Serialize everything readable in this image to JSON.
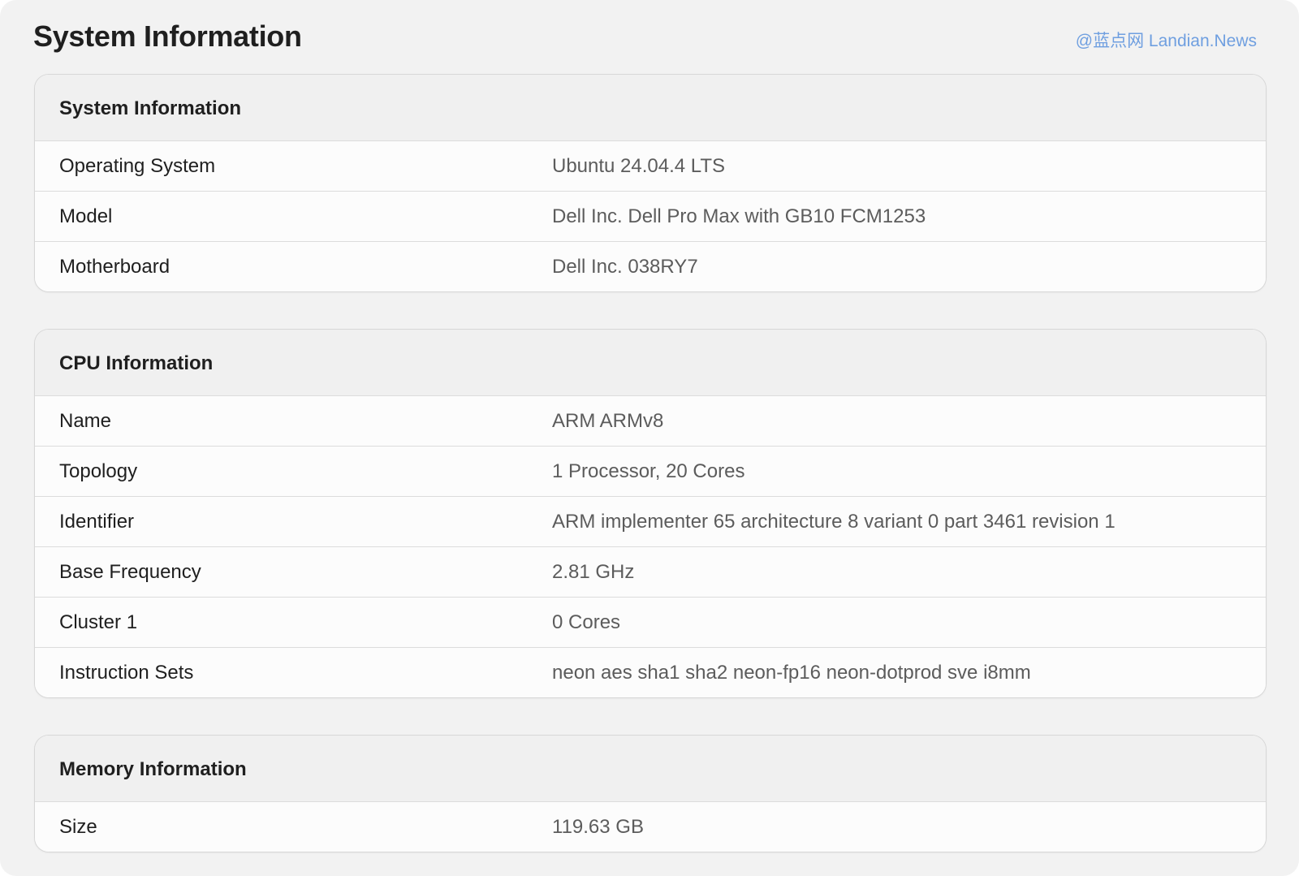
{
  "page": {
    "title": "System Information",
    "watermark": "@蓝点网 Landian.News"
  },
  "cards": [
    {
      "header": "System Information",
      "rows": [
        {
          "label": "Operating System",
          "value": "Ubuntu 24.04.4 LTS"
        },
        {
          "label": "Model",
          "value": "Dell Inc. Dell Pro Max with GB10 FCM1253"
        },
        {
          "label": "Motherboard",
          "value": "Dell Inc. 038RY7"
        }
      ]
    },
    {
      "header": "CPU Information",
      "rows": [
        {
          "label": "Name",
          "value": "ARM ARMv8"
        },
        {
          "label": "Topology",
          "value": "1 Processor, 20 Cores"
        },
        {
          "label": "Identifier",
          "value": "ARM implementer 65 architecture 8 variant 0 part 3461 revision 1"
        },
        {
          "label": "Base Frequency",
          "value": "2.81 GHz"
        },
        {
          "label": "Cluster 1",
          "value": "0 Cores"
        },
        {
          "label": "Instruction Sets",
          "value": "neon aes sha1 sha2 neon-fp16 neon-dotprod sve i8mm"
        }
      ]
    },
    {
      "header": "Memory Information",
      "rows": [
        {
          "label": "Size",
          "value": "119.63 GB"
        }
      ]
    }
  ]
}
